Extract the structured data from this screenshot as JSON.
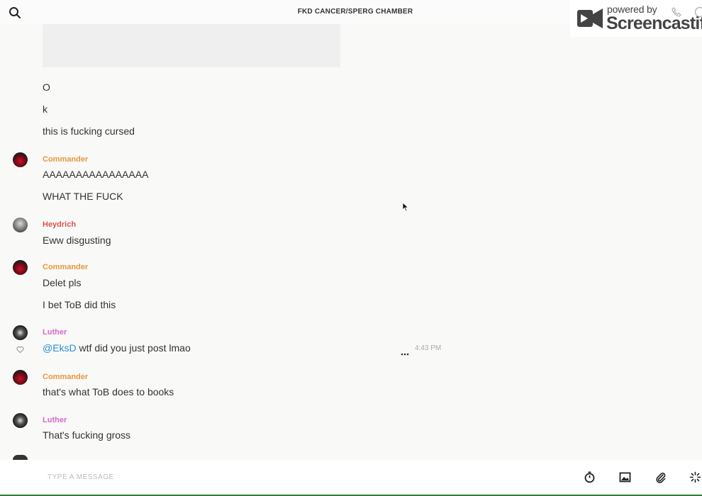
{
  "header": {
    "room_title": "FKD CANCER/SPERG CHAMBER"
  },
  "watermark": {
    "small": "powered by",
    "big": "Screencastify"
  },
  "messages": [
    {
      "text": "O"
    },
    {
      "text": "k"
    },
    {
      "text": "this is fucking cursed"
    },
    {
      "author": "Commander",
      "lines": [
        "AAAAAAAAAAAAAAAA",
        "WHAT THE FUCK"
      ]
    },
    {
      "author": "Heydrich",
      "lines": [
        "Eww disgusting"
      ]
    },
    {
      "author": "Commander",
      "lines": [
        "Delet pls",
        "I bet ToB did this"
      ]
    },
    {
      "author": "Luther",
      "mention": "@EksD",
      "text": " wtf did you just post lmao",
      "time": "4:43 PM"
    },
    {
      "author": "Commander",
      "lines": [
        "that's what ToB does to books"
      ]
    },
    {
      "author": "Luther",
      "lines": [
        "That's fucking gross"
      ]
    }
  ],
  "author_colors": {
    "Commander": "#e8973f",
    "Heydrich": "#d9534f",
    "Luther": "#d669c4"
  },
  "composer": {
    "placeholder": "TYPE A MESSAGE"
  },
  "icons": [
    "search-icon",
    "phone-icon",
    "info-icon",
    "heart-icon",
    "more-icon",
    "timer-icon",
    "image-icon",
    "attachment-icon",
    "sparkle-icon"
  ]
}
